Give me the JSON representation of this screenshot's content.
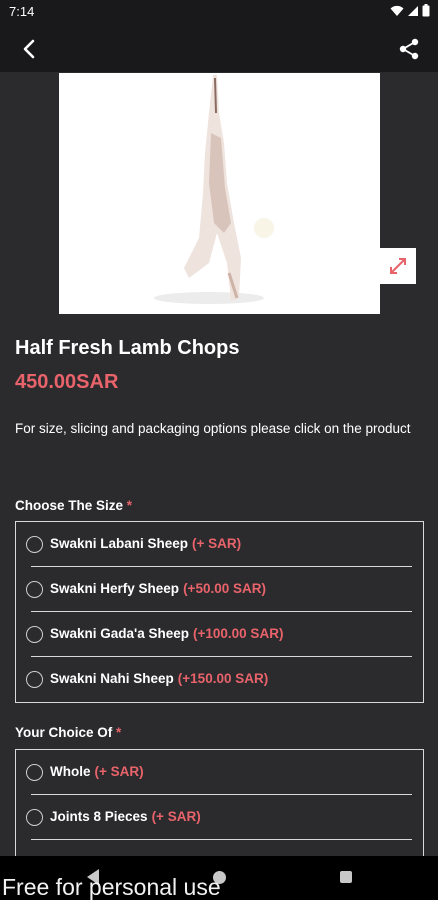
{
  "status": {
    "time": "7:14"
  },
  "product": {
    "title": "Half Fresh Lamb Chops",
    "price": "450.00SAR",
    "description": "For size, slicing and packaging options please click on the product"
  },
  "size_section": {
    "label": "Choose The Size",
    "required_mark": "*",
    "options": [
      {
        "name": "Swakni Labani Sheep",
        "price": "(+ SAR)"
      },
      {
        "name": "Swakni Herfy Sheep",
        "price": "(+50.00 SAR)"
      },
      {
        "name": "Swakni Gada'a Sheep",
        "price": "(+100.00 SAR)"
      },
      {
        "name": "Swakni Nahi Sheep",
        "price": "(+150.00 SAR)"
      }
    ]
  },
  "choice_section": {
    "label": "Your Choice Of",
    "required_mark": "*",
    "options": [
      {
        "name": "Whole",
        "price": "(+ SAR)"
      },
      {
        "name": "Joints 8 Pieces",
        "price": "(+ SAR)"
      }
    ]
  },
  "watermark": "Free for personal use",
  "icons": {
    "back": "arrow-back-icon",
    "share": "share-icon",
    "zoom": "expand-icon",
    "wifi": "wifi-icon",
    "signal": "signal-icon",
    "battery": "battery-icon"
  },
  "colors": {
    "accent": "#e9636b",
    "background": "#2b2b2e",
    "appbar": "#19191b"
  }
}
